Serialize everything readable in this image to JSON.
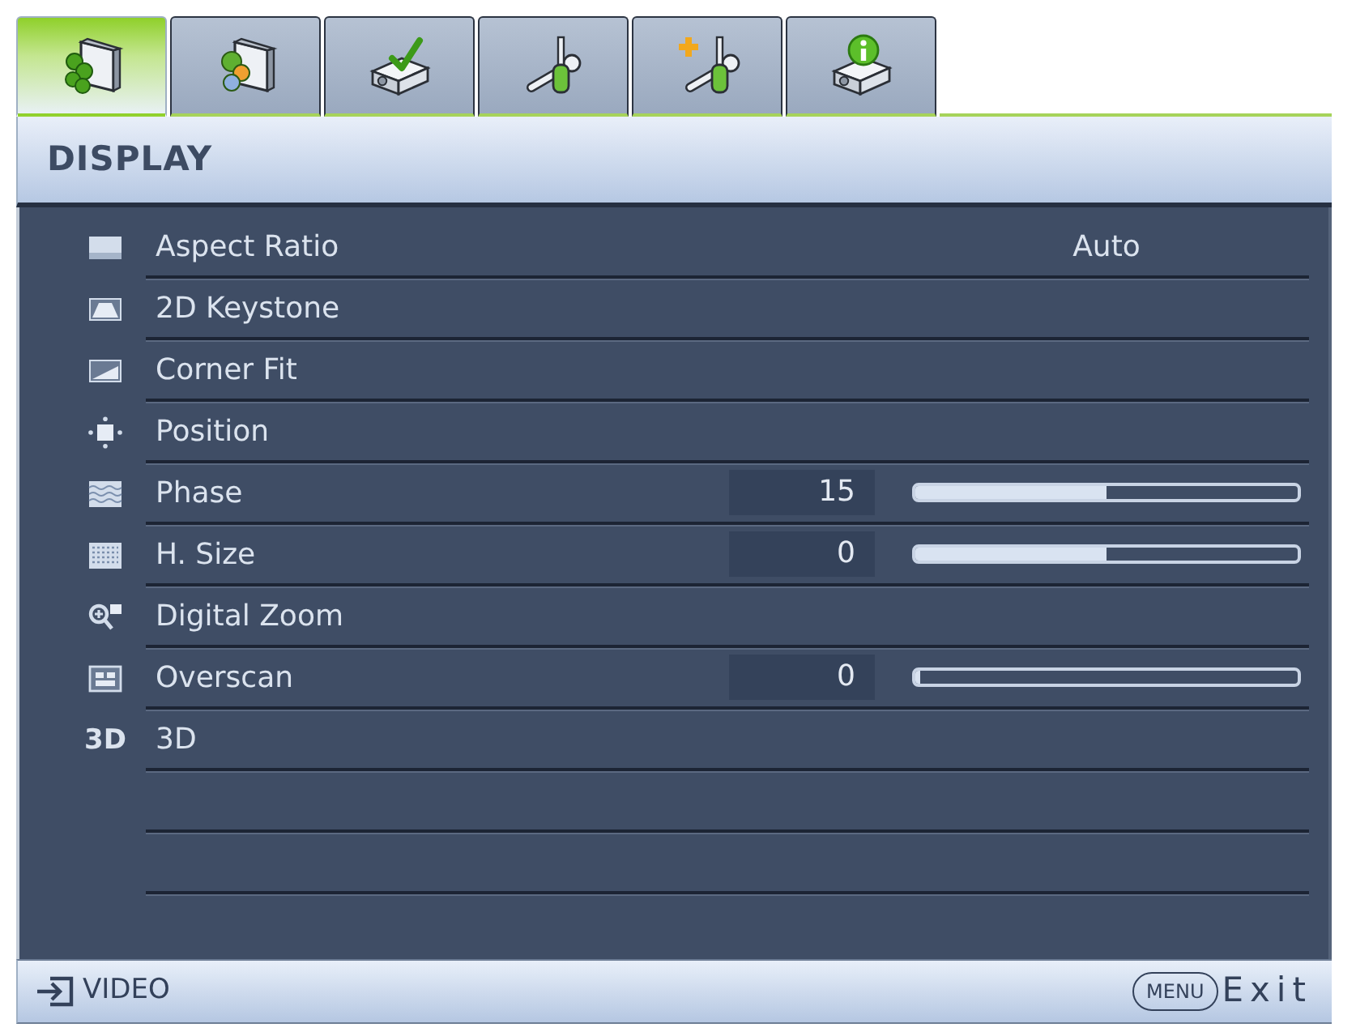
{
  "tabs": [
    {
      "selected": true
    },
    {
      "selected": false
    },
    {
      "selected": false
    },
    {
      "selected": false
    },
    {
      "selected": false
    },
    {
      "selected": false
    }
  ],
  "menu": {
    "title": "DISPLAY",
    "items": [
      {
        "kind": "option",
        "label": "Aspect Ratio",
        "value": "Auto"
      },
      {
        "kind": "plain",
        "label": "2D Keystone"
      },
      {
        "kind": "plain",
        "label": "Corner Fit"
      },
      {
        "kind": "plain",
        "label": "Position"
      },
      {
        "kind": "slider",
        "label": "Phase",
        "reading": "15",
        "level": 0.5
      },
      {
        "kind": "slider",
        "label": "H. Size",
        "reading": "0",
        "level": 0.5
      },
      {
        "kind": "plain",
        "label": "Digital Zoom"
      },
      {
        "kind": "slider",
        "label": "Overscan",
        "reading": "0",
        "level": 0
      },
      {
        "kind": "plain",
        "label": "3D",
        "icon_text": "3D"
      }
    ]
  },
  "footer": {
    "source": "VIDEO",
    "menu_key": "MENU",
    "exit": "Exit"
  }
}
